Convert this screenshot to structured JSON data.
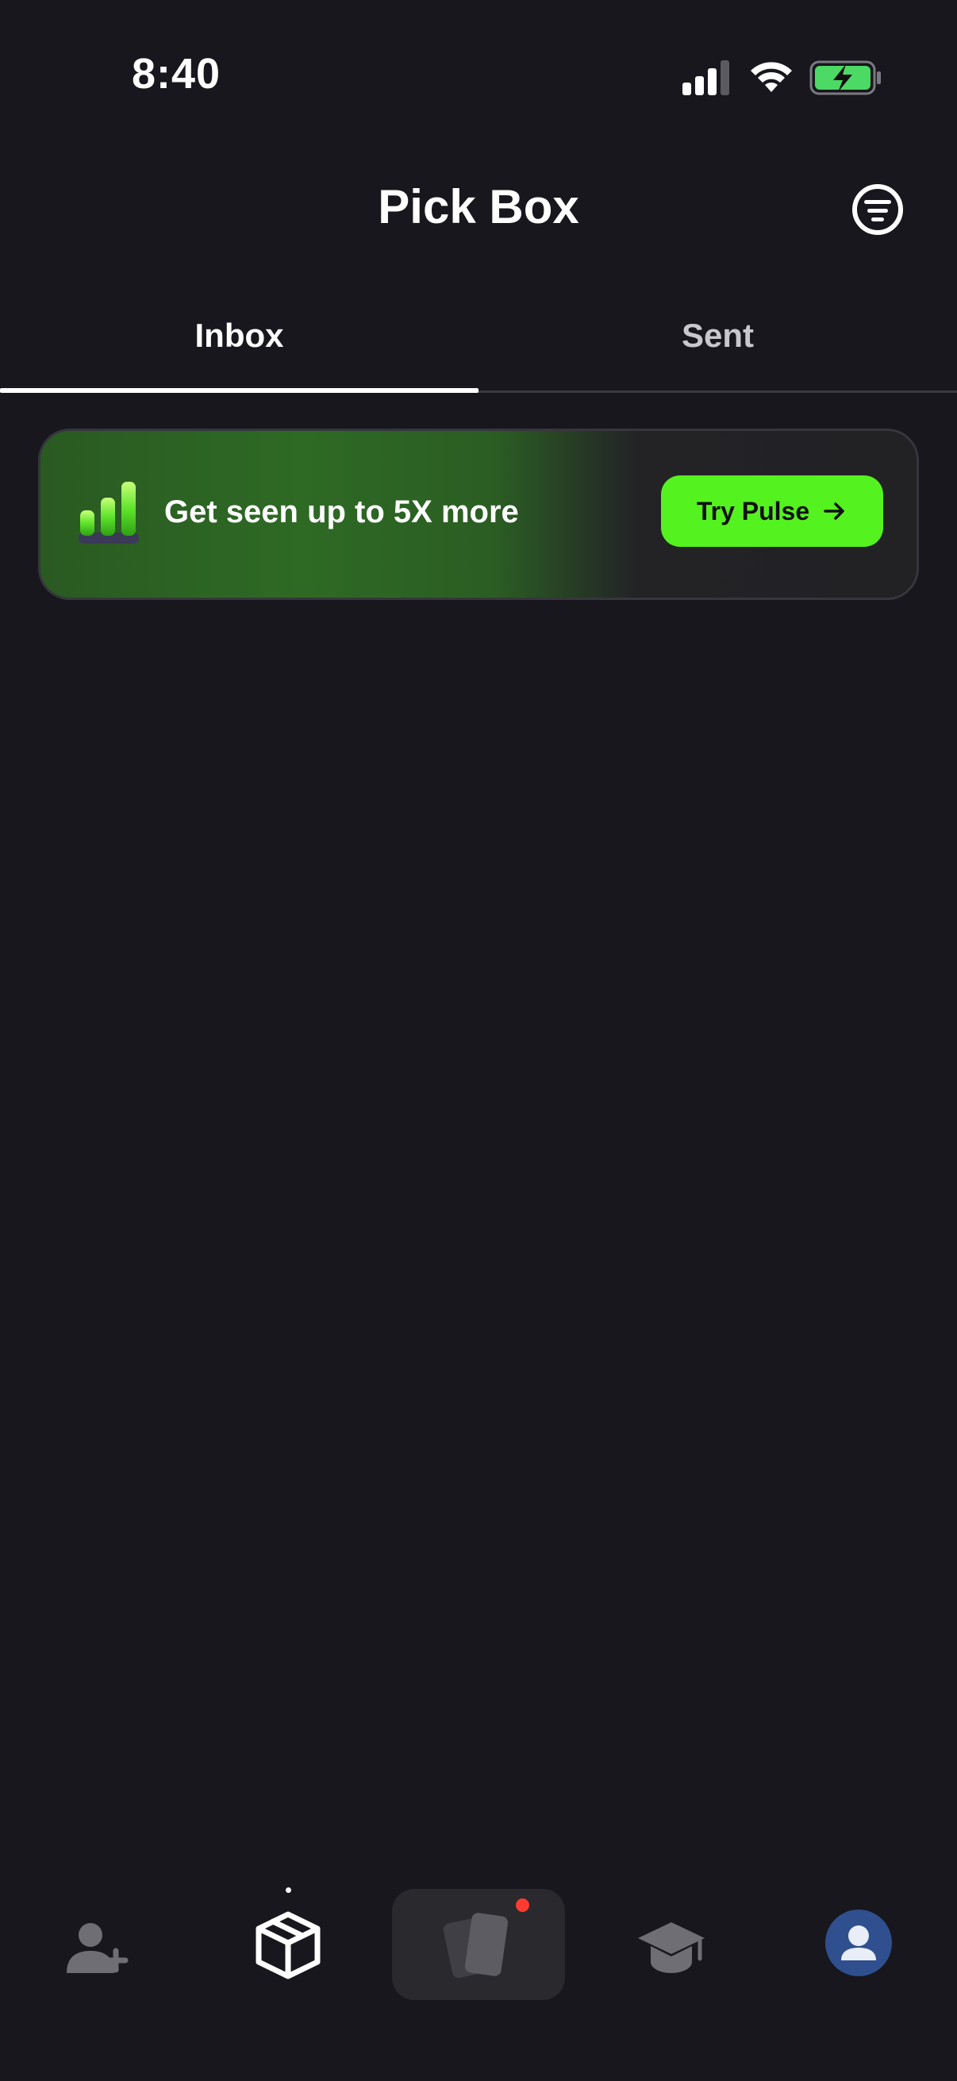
{
  "status_bar": {
    "time": "8:40",
    "icons": [
      "signal-icon",
      "wifi-icon",
      "battery-charging-icon"
    ],
    "battery_color": "#4cd964"
  },
  "header": {
    "title": "Pick Box",
    "filter_icon": "filter-icon"
  },
  "tabs": [
    {
      "label": "Inbox",
      "active": true
    },
    {
      "label": "Sent",
      "active": false
    }
  ],
  "promo": {
    "icon": "bar-chart-icon",
    "text": "Get seen up to 5X more",
    "button_label": "Try Pulse",
    "button_icon": "arrow-right-icon",
    "accent_color": "#54f21f"
  },
  "bottom_nav": {
    "items": [
      {
        "icon": "add-friend-icon",
        "active": false
      },
      {
        "icon": "box-icon",
        "active": true
      },
      {
        "icon": "cards-icon",
        "active": false,
        "has_notification": true
      },
      {
        "icon": "graduation-cap-icon",
        "active": false
      },
      {
        "icon": "profile-avatar-icon",
        "active": false
      }
    ],
    "notification_color": "#ff3b30"
  }
}
